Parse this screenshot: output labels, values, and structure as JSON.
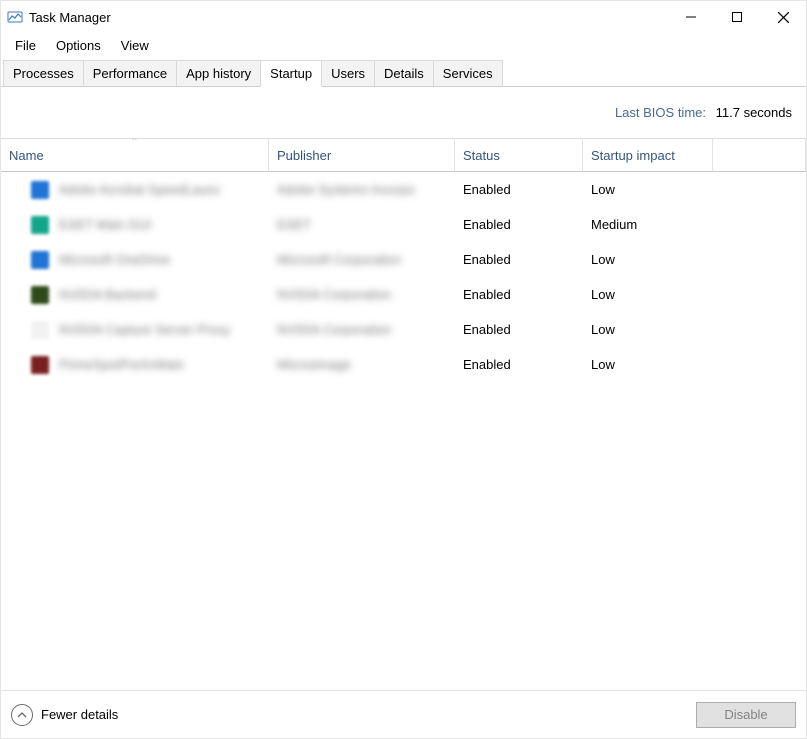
{
  "titlebar": {
    "title": "Task Manager"
  },
  "menubar": {
    "items": [
      "File",
      "Options",
      "View"
    ]
  },
  "tabs": {
    "items": [
      "Processes",
      "Performance",
      "App history",
      "Startup",
      "Users",
      "Details",
      "Services"
    ],
    "active_index": 3
  },
  "bios": {
    "label": "Last BIOS time:",
    "value": "11.7 seconds"
  },
  "columns": {
    "name": "Name",
    "publisher": "Publisher",
    "status": "Status",
    "impact": "Startup impact"
  },
  "rows": [
    {
      "icon_color": "#1f74d6",
      "name_blurred": "Adobe Acrobat SpeedLaunc",
      "publisher_blurred": "Adobe Systems Incorpo",
      "status": "Enabled",
      "impact": "Low"
    },
    {
      "icon_color": "#11a58a",
      "name_blurred": "ESET Main GUI",
      "publisher_blurred": "ESET",
      "status": "Enabled",
      "impact": "Medium"
    },
    {
      "icon_color": "#1f74d6",
      "name_blurred": "Microsoft OneDrive",
      "publisher_blurred": "Microsoft Corporation",
      "status": "Enabled",
      "impact": "Low"
    },
    {
      "icon_color": "#2e4a1a",
      "name_blurred": "NVIDIA Backend",
      "publisher_blurred": "NVIDIA Corporation",
      "status": "Enabled",
      "impact": "Low"
    },
    {
      "icon_color": "#f2f2f2",
      "name_blurred": "NVIDIA Capture Server Proxy",
      "publisher_blurred": "NVIDIA Corporation",
      "status": "Enabled",
      "impact": "Low"
    },
    {
      "icon_color": "#7a1f1f",
      "name_blurred": "PrimeSpotPreXnMain",
      "publisher_blurred": "Microsimage",
      "status": "Enabled",
      "impact": "Low"
    }
  ],
  "footer": {
    "fewer_details": "Fewer details",
    "disable": "Disable"
  }
}
